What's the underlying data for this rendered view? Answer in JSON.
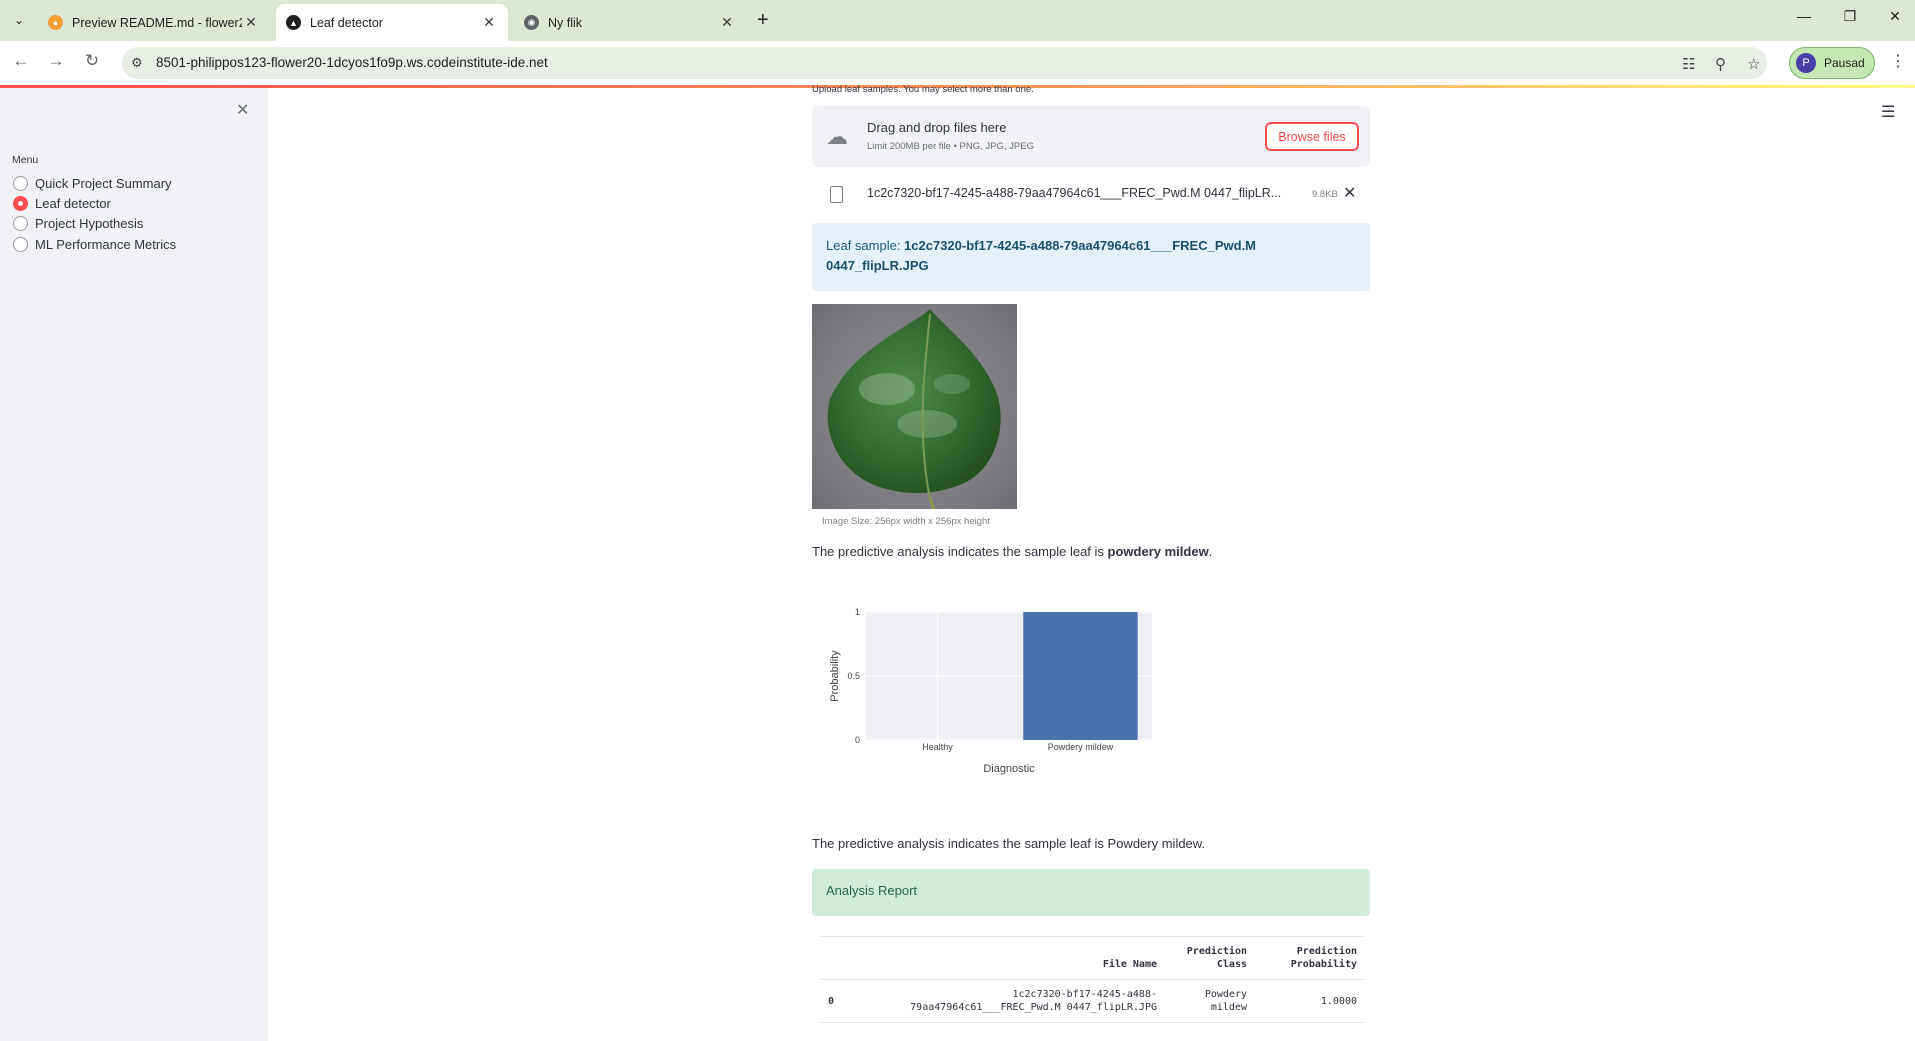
{
  "browser": {
    "tabs": [
      {
        "label": "Preview README.md - flower2",
        "favicon": "gitpod-icon",
        "active": false
      },
      {
        "label": "Leaf detector",
        "favicon": "streamlit-icon",
        "active": true
      },
      {
        "label": "Ny flik",
        "favicon": "chrome-icon",
        "active": false
      }
    ],
    "url": "8501-philippos123-flower20-1dcyos1fo9p.ws.codeinstitute-ide.net",
    "profile_label": "Pausad",
    "profile_initial": "P"
  },
  "sidebar": {
    "menu_label": "Menu",
    "items": [
      {
        "label": "Quick Project Summary",
        "selected": false
      },
      {
        "label": "Leaf detector",
        "selected": true
      },
      {
        "label": "Project Hypothesis",
        "selected": false
      },
      {
        "label": "ML Performance Metrics",
        "selected": false
      }
    ]
  },
  "uploader": {
    "cutoff_label": "Upload leaf samples. You may select more than one.",
    "drag_text": "Drag and drop files here",
    "limit_text": "Limit 200MB per file • PNG, JPG, JPEG",
    "browse_label": "Browse files",
    "file_name": "1c2c7320-bf17-4245-a488-79aa47964c61___FREC_Pwd.M 0447_flipLR...",
    "file_size": "9.8KB"
  },
  "sample": {
    "info_prefix": "Leaf sample: ",
    "info_name_line1": "1c2c7320-bf17-4245-a488-79aa47964c61___FREC_Pwd.M",
    "info_name_line2": "0447_flipLR.JPG",
    "caption": "Image Size: 256px width x 256px height"
  },
  "prediction": {
    "text1_prefix": "The predictive analysis indicates the sample leaf is ",
    "text1_bold": "powdery mildew",
    "text1_suffix": ".",
    "text2": "The predictive analysis indicates the sample leaf is Powdery mildew.",
    "report_label": "Analysis Report"
  },
  "chart_data": {
    "type": "bar",
    "categories": [
      "Healthy",
      "Powdery mildew"
    ],
    "values": [
      0,
      1
    ],
    "title": "",
    "xlabel": "Diagnostic",
    "ylabel": "Probability",
    "ylim": [
      0,
      1
    ],
    "yticks": [
      0,
      0.5,
      1
    ],
    "ytick_labels": [
      "0",
      "0.5",
      "1"
    ],
    "bar_color": "#4c72b0",
    "plot_bg": "#eef0f5",
    "grid": true
  },
  "report_table": {
    "headers": [
      "",
      "File Name",
      "Prediction Class",
      "Prediction Probability"
    ],
    "header_lines": [
      [
        ""
      ],
      [
        "File Name"
      ],
      [
        "Prediction",
        "Class"
      ],
      [
        "Prediction",
        "Probability"
      ]
    ],
    "rows": [
      {
        "index": "0",
        "file_name_line1": "1c2c7320-bf17-4245-a488-",
        "file_name_line2": "79aa47964c61___FREC_Pwd.M 0447_flipLR.JPG",
        "class_line1": "Powdery",
        "class_line2": "mildew",
        "probability": "1.0000"
      }
    ]
  },
  "colors": {
    "accent": "#ff4b4b",
    "info_bg": "#e5f0fb",
    "success_bg": "#d3ebdb",
    "sidebar_bg": "#f0f2f6"
  }
}
